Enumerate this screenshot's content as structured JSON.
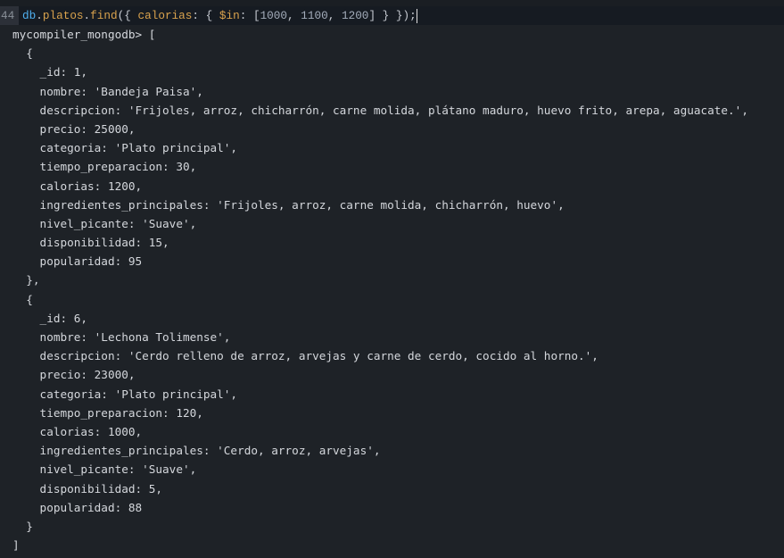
{
  "command": {
    "line_number": "44",
    "tokens": [
      {
        "t": "db",
        "c": "db"
      },
      {
        "t": ".",
        "c": "punc"
      },
      {
        "t": "platos",
        "c": "fn"
      },
      {
        "t": ".",
        "c": "punc"
      },
      {
        "t": "find",
        "c": "fn"
      },
      {
        "t": "({ ",
        "c": "punc"
      },
      {
        "t": "calorias",
        "c": "fn"
      },
      {
        "t": ": { ",
        "c": "punc"
      },
      {
        "t": "$in",
        "c": "fn"
      },
      {
        "t": ": [",
        "c": "punc"
      },
      {
        "t": "1000",
        "c": "num"
      },
      {
        "t": ", ",
        "c": "punc"
      },
      {
        "t": "1100",
        "c": "num"
      },
      {
        "t": ", ",
        "c": "punc"
      },
      {
        "t": "1200",
        "c": "num"
      },
      {
        "t": "] } });",
        "c": "punc"
      }
    ]
  },
  "output_lines": [
    "mycompiler_mongodb> [",
    "  {",
    "    _id: 1,",
    "    nombre: 'Bandeja Paisa',",
    "    descripcion: 'Frijoles, arroz, chicharrón, carne molida, plátano maduro, huevo frito, arepa, aguacate.',",
    "    precio: 25000,",
    "    categoria: 'Plato principal',",
    "    tiempo_preparacion: 30,",
    "    calorias: 1200,",
    "    ingredientes_principales: 'Frijoles, arroz, carne molida, chicharrón, huevo',",
    "    nivel_picante: 'Suave',",
    "    disponibilidad: 15,",
    "    popularidad: 95",
    "  },",
    "  {",
    "    _id: 6,",
    "    nombre: 'Lechona Tolimense',",
    "    descripcion: 'Cerdo relleno de arroz, arvejas y carne de cerdo, cocido al horno.',",
    "    precio: 23000,",
    "    categoria: 'Plato principal',",
    "    tiempo_preparacion: 120,",
    "    calorias: 1000,",
    "    ingredientes_principales: 'Cerdo, arroz, arvejas',",
    "    nivel_picante: 'Suave',",
    "    disponibilidad: 5,",
    "    popularidad: 88",
    "  }",
    "]"
  ],
  "colors": {
    "background": "#1e2227",
    "keyword": "#4fb0f0",
    "method": "#d9a24d",
    "number": "#a3acba"
  }
}
